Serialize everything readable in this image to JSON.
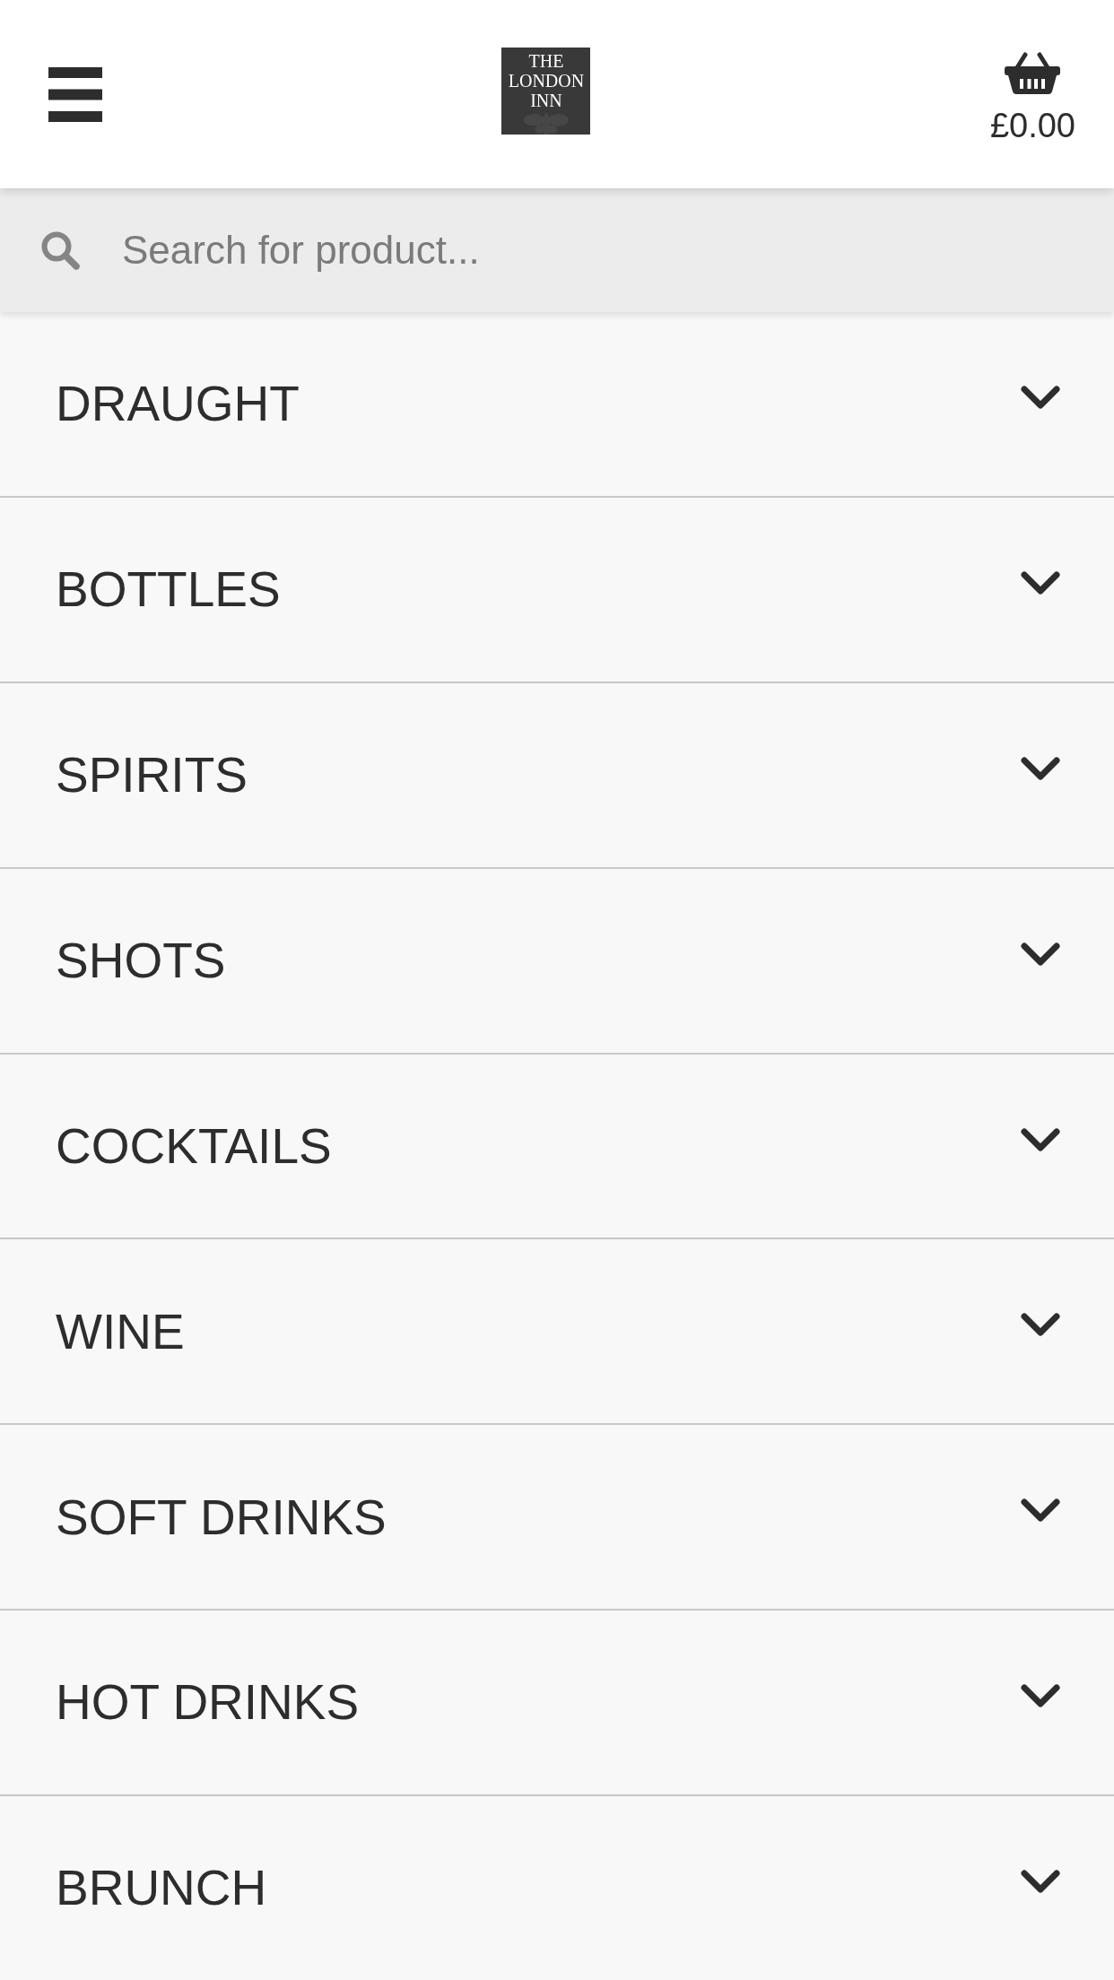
{
  "header": {
    "logo": {
      "text": "THE LONDON INN"
    },
    "cart": {
      "total": "£0.00"
    }
  },
  "search": {
    "placeholder": "Search for product..."
  },
  "categories": [
    {
      "label": "DRAUGHT",
      "expanded": false
    },
    {
      "label": "BOTTLES",
      "expanded": false
    },
    {
      "label": "SPIRITS",
      "expanded": false
    },
    {
      "label": "SHOTS",
      "expanded": false
    },
    {
      "label": "COCKTAILS",
      "expanded": false
    },
    {
      "label": "WINE",
      "expanded": false
    },
    {
      "label": "SOFT DRINKS",
      "expanded": false
    },
    {
      "label": "HOT DRINKS",
      "expanded": false
    },
    {
      "label": "BRUNCH",
      "expanded": false
    }
  ]
}
